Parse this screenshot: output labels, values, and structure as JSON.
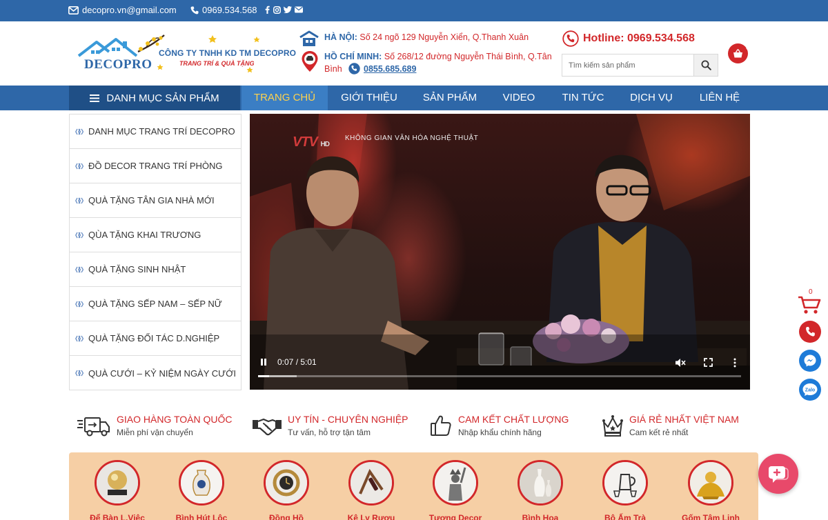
{
  "topbar": {
    "email": "decopro.vn@gmail.com",
    "phone": "0969.534.568"
  },
  "header": {
    "company_name": "CÔNG TY TNHH KD TM DECOPRO",
    "tagline": "TRANG TRÍ & QUÀ TẶNG",
    "brand": "DECOPRO",
    "hanoi_label": "HÀ NỘI:",
    "hanoi_address": "Số 24 ngõ 129 Nguyễn Xiển, Q.Thanh Xuân",
    "hcm_label": "HỒ CHÍ MINH:",
    "hcm_address_line1": "Số 268/12 đường Nguyễn Thái Bình, Q.Tân",
    "hcm_address_line2": "Bình",
    "hcm_phone": "0855.685.689",
    "hotline": "Hotline: 0969.534.568",
    "search_placeholder": "Tìm kiếm sản phẩm",
    "cart_count": "0"
  },
  "nav": {
    "category_heading": "DANH MỤC SẢN PHẨM",
    "items": [
      {
        "label": "TRANG CHỦ"
      },
      {
        "label": "GIỚI THIỆU"
      },
      {
        "label": "SẢN PHẨM"
      },
      {
        "label": "VIDEO"
      },
      {
        "label": "TIN TỨC"
      },
      {
        "label": "DỊCH VỤ"
      },
      {
        "label": "LIÊN HỆ"
      }
    ]
  },
  "sidebar": {
    "items": [
      {
        "label": "DANH MỤC TRANG TRÍ DECOPRO"
      },
      {
        "label": "ĐỒ DECOR TRANG TRÍ PHÒNG"
      },
      {
        "label": "QUÀ TẶNG TÂN GIA NHÀ MỚI"
      },
      {
        "label": "QÙA TẶNG KHAI TRƯƠNG"
      },
      {
        "label": "QUÀ TẶNG SINH NHẬT"
      },
      {
        "label": "QUÀ TẶNG SẾP NAM – SẾP NỮ"
      },
      {
        "label": "QUÀ TẶNG ĐỐI TÁC D.NGHIỆP"
      },
      {
        "label": "QUÀ CƯỚI – KỶ NIỆM NGÀY CƯỚI"
      }
    ]
  },
  "video": {
    "channel_logo": "VTV",
    "channel_sub": "HD",
    "show_title": "KHÔNG GIAN VĂN HÓA NGHỆ THUẬT",
    "time": "0:07 / 5:01",
    "progress_fraction": 0.023,
    "buffered_fraction": 0.08
  },
  "features": [
    {
      "title": "GIAO HÀNG TOÀN QUỐC",
      "sub": "Miễn phí vận chuyển",
      "icon": "delivery-truck-icon"
    },
    {
      "title": "UY TÍN - CHUYÊN NGHIỆP",
      "sub": "Tư vấn, hỗ trợ tận tâm",
      "icon": "handshake-icon"
    },
    {
      "title": "CAM KẾT CHẤT LƯỢNG",
      "sub": "Nhập khẩu chính hãng",
      "icon": "thumbs-up-icon"
    },
    {
      "title": "GIÁ RẺ NHẤT VIỆT NAM",
      "sub": "Cam kết rẻ nhất",
      "icon": "crown-icon"
    }
  ],
  "categories": [
    {
      "label": "Để Bàn L.Việc"
    },
    {
      "label": "Bình Hút Lộc"
    },
    {
      "label": "Đồng Hồ"
    },
    {
      "label": "Kệ Ly Rượu"
    },
    {
      "label": "Tượng Decor"
    },
    {
      "label": "Bình Hoa"
    },
    {
      "label": "Bộ Ấm Trà"
    },
    {
      "label": "Gốm Tâm Linh"
    }
  ],
  "floating": {
    "cart_count": "0"
  },
  "colors": {
    "primary_blue": "#2e67a8",
    "accent_red": "#d2272a",
    "nav_active_text": "#ffd24d",
    "panel_bg": "#f6cfa5"
  }
}
